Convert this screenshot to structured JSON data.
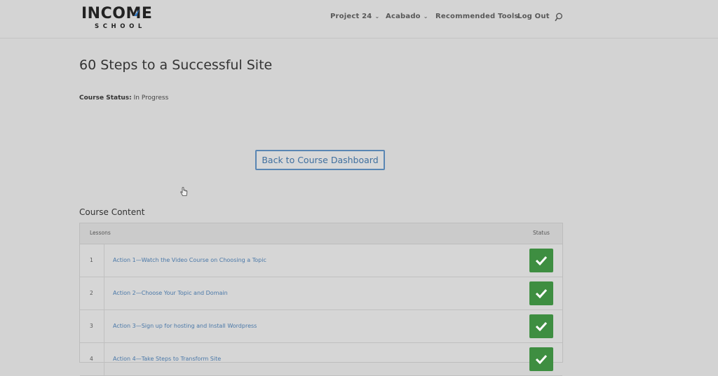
{
  "brand": {
    "logo_main": "INCOME",
    "logo_sub": "SCHOOL"
  },
  "nav": {
    "items": [
      {
        "label": "Project 24",
        "has_dropdown": true
      },
      {
        "label": "Acabado",
        "has_dropdown": true
      },
      {
        "label": "Recommended Tools",
        "has_dropdown": false
      },
      {
        "label": "Log Out",
        "has_dropdown": false
      }
    ],
    "search_icon": "search-icon"
  },
  "course": {
    "title": "60 Steps to a Successful Site",
    "status_label": "Course Status:",
    "status_value": "In Progress",
    "back_button": "Back to Course Dashboard"
  },
  "content": {
    "section_title": "Course Content",
    "columns": {
      "lessons": "Lessons",
      "status": "Status"
    },
    "lessons": [
      {
        "num": "1",
        "title": "Action 1—Watch the Video Course on Choosing a Topic",
        "complete": true
      },
      {
        "num": "2",
        "title": "Action 2—Choose Your Topic and Domain",
        "complete": true
      },
      {
        "num": "3",
        "title": "Action 3—Sign up for hosting and Install Wordpress",
        "complete": true
      },
      {
        "num": "4",
        "title": "Action 4—Take Steps to Transform Site",
        "complete": true
      }
    ]
  },
  "colors": {
    "accent": "#3f6f9e",
    "complete": "#3e8e41"
  }
}
